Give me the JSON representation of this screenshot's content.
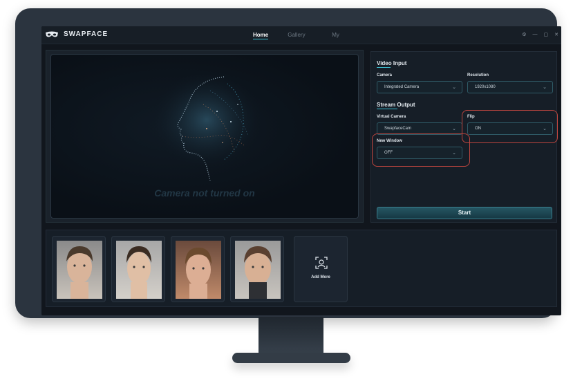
{
  "app": {
    "name": "SWAPFACE"
  },
  "nav": {
    "items": [
      {
        "label": "Home",
        "active": true
      },
      {
        "label": "Gallery"
      },
      {
        "label": "My"
      }
    ]
  },
  "window_controls": {
    "settings": "⚙",
    "minimize": "—",
    "maximize": "▢",
    "close": "✕"
  },
  "preview": {
    "message": "Camera not turned on"
  },
  "video_input": {
    "title": "Video Input",
    "camera": {
      "label": "Camera",
      "value": "Integrated Camera"
    },
    "resolution": {
      "label": "Resolution",
      "value": "1920x1080"
    }
  },
  "stream_output": {
    "title": "Stream Output",
    "virtual_camera": {
      "label": "Virtual Camera",
      "value": "SwapfaceCam"
    },
    "flip": {
      "label": "Flip",
      "value": "ON"
    },
    "new_window": {
      "label": "New Window",
      "value": "OFF"
    }
  },
  "start_button": {
    "label": "Start"
  },
  "gallery": {
    "add_more_label": "Add More",
    "face_count": 4
  },
  "colors": {
    "accent": "#3ec3d6",
    "highlight": "#c0463f",
    "bg": "#11161d"
  }
}
